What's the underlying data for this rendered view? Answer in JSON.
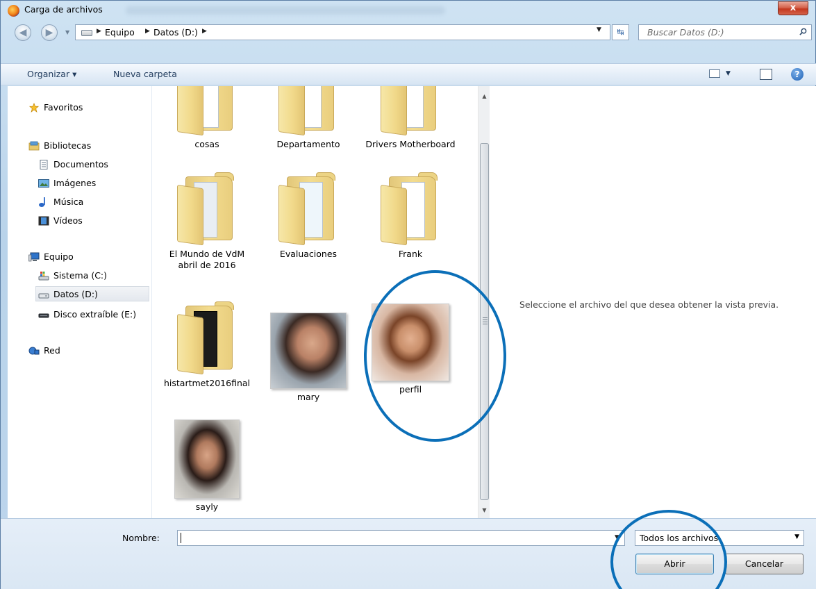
{
  "window": {
    "title": "Carga de archivos",
    "close_label": "x"
  },
  "address": {
    "crumbs": [
      "Equipo",
      "Datos (D:)"
    ],
    "search_placeholder": "Buscar Datos (D:)"
  },
  "toolbar": {
    "organize": "Organizar ▾",
    "new_folder": "Nueva carpeta"
  },
  "sidebar": {
    "favorites": "Favoritos",
    "libraries": "Bibliotecas",
    "lib_items": [
      "Documentos",
      "Imágenes",
      "Música",
      "Vídeos"
    ],
    "computer": "Equipo",
    "drives": [
      "Sistema (C:)",
      "Datos (D:)",
      "Disco extraíble (E:)"
    ],
    "network": "Red"
  },
  "files": [
    {
      "name": "cosas",
      "kind": "folder"
    },
    {
      "name": "Departamento",
      "kind": "folder"
    },
    {
      "name": "Drivers Motherboard",
      "kind": "folder"
    },
    {
      "name": "El Mundo de VdM abril de 2016",
      "kind": "folder"
    },
    {
      "name": "Evaluaciones",
      "kind": "folder"
    },
    {
      "name": "Frank",
      "kind": "folder"
    },
    {
      "name": "histartmet2016final",
      "kind": "folder"
    },
    {
      "name": "mary",
      "kind": "image"
    },
    {
      "name": "perfil",
      "kind": "image"
    },
    {
      "name": "sayly",
      "kind": "image"
    }
  ],
  "preview": {
    "message": "Seleccione el archivo del que desea obtener la vista previa."
  },
  "bottom": {
    "name_label": "Nombre:",
    "name_value": "",
    "filter": "Todos los archivos",
    "open": "Abrir",
    "cancel": "Cancelar"
  },
  "colors": {
    "annotation": "#0b6fb8",
    "accent": "#3c7fb1"
  }
}
